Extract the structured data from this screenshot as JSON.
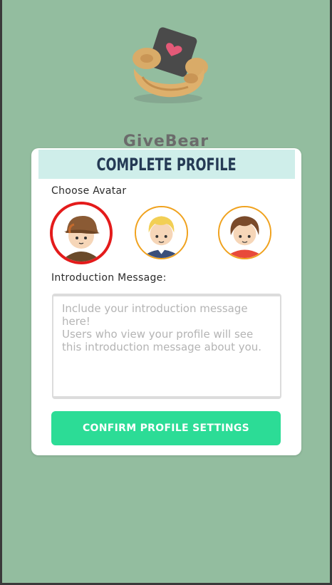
{
  "brand": {
    "name": "GiveBear",
    "name_color": "#6b6b6b"
  },
  "profile_card": {
    "title": "COMPLETE PROFILE",
    "header_bg": "#cfeeea",
    "choose_avatar_label": "Choose Avatar",
    "avatars": [
      {
        "name": "avatar-boy-cap",
        "selected": true
      },
      {
        "name": "avatar-blond-boy",
        "selected": false
      },
      {
        "name": "avatar-brown-hair-boy",
        "selected": false
      }
    ],
    "intro_label": "Introduction Message:",
    "intro_placeholder": "Include your introduction message here!\nUsers who view your profile will see this introduction message about you.",
    "intro_value": "",
    "confirm_label": "CONFIRM PROFILE SETTINGS",
    "confirm_color": "#2cdc96"
  },
  "colors": {
    "background": "#93bd9f",
    "selected_ring": "#e41b1b",
    "avatar_ring": "#f0a21e"
  }
}
